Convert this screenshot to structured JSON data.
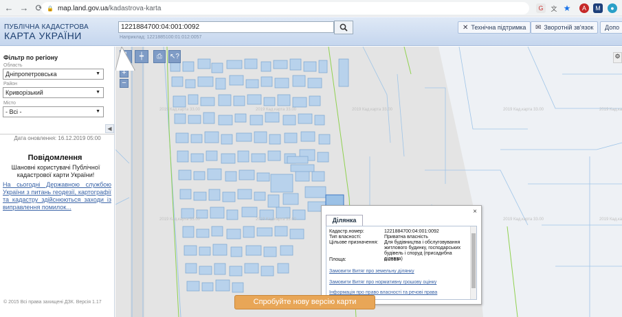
{
  "browser": {
    "url_host": "map.land.gov.ua",
    "url_path": "/kadastrova-karta"
  },
  "header": {
    "logo_line1": "ПУБЛІЧНА КАДАСТРОВА",
    "logo_line2": "КАРТА УКРАЇНИ",
    "search_value": "1221884700:04:001:0092",
    "search_hint": "Наприклад: 1221885100:01:012:0057",
    "support_label": "Технічна підтримка",
    "feedback_label": "Зворотній зв'язок",
    "help_label": "Допо"
  },
  "sidebar": {
    "filter_title": "Фільтр по регіону",
    "oblast_label": "Область",
    "oblast_value": "Дніпропетровська",
    "raion_label": "Район",
    "raion_value": "Криворізький",
    "misto_label": "Місто",
    "misto_value": "- Всі -",
    "updated": "Дата оновлення: 16.12.2019 05:00",
    "notice_title": "Повідомлення",
    "notice_text": "Шановні користувачі Публічної кадастрової карти України!",
    "notice_link": "На сьогодні Державною службою України з питань геодезії, картографії та кадастру здійснюються заходи із виправлення помилок...",
    "copyright": "© 2015 Всі права захищені ДЗК. Версія 1.17"
  },
  "map": {
    "watermark": "2019 Кад.карта 33.00",
    "new_version_button": "Спробуйте нову версію карти"
  },
  "popup": {
    "tab_label": "Ділянка",
    "close": "×",
    "fields": [
      {
        "key": "Кадастр.номер:",
        "value": "1221884700:04:001:0092"
      },
      {
        "key": "Тип власності:",
        "value": "Приватна власність"
      },
      {
        "key": "Цільове призначення:",
        "value": "Для будівництва і обслуговування житлового будинку, господарських будівель і споруд (присадибна ділянка)"
      },
      {
        "key": "Площа:",
        "value": "0.2513"
      }
    ],
    "link_order_extract": "Замовити Витяг про земельну ділянку",
    "link_order_normative": "Замовити Витяг про нормативну грошову оцінку",
    "link_property_rights": "Інформація про право власності та речові права"
  },
  "colors": {
    "parcel_fill": "#b8d2ec",
    "parcel_stroke": "#7aa5d1",
    "boundary_green": "#8fd14f",
    "tool_blue": "#7f9cc6",
    "orange_button": "#e8a657"
  }
}
